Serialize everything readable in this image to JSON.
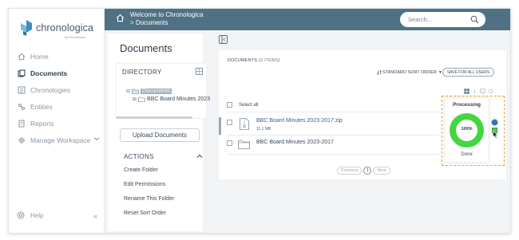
{
  "app": {
    "name": "chronologica",
    "tagline": "by Recordsure"
  },
  "nav": {
    "items": [
      {
        "label": "Home",
        "icon": "home-icon"
      },
      {
        "label": "Documents",
        "icon": "documents-icon",
        "active": true
      },
      {
        "label": "Chronologies",
        "icon": "chronologies-icon"
      },
      {
        "label": "Entities",
        "icon": "entities-icon"
      },
      {
        "label": "Reports",
        "icon": "reports-icon"
      },
      {
        "label": "Manage Workspace",
        "icon": "gear-icon"
      }
    ],
    "help_label": "Help"
  },
  "header": {
    "crumb_title": "Welcome to Chronologica",
    "crumb_sub": "> Documents",
    "search_placeholder": "Search..."
  },
  "documents": {
    "title": "Documents",
    "directory_label": "DIRECTORY",
    "tree": {
      "root": "Documents",
      "child": "BBC Board Minutes 2023"
    },
    "upload_label": "Upload Documents",
    "actions_label": "ACTIONS",
    "actions": [
      "Create Folder",
      "Edit Permissions",
      "Rename This Folder",
      "Reset Sort Order"
    ]
  },
  "list": {
    "title": "DOCUMENTS",
    "count": "(2 ITEMS)",
    "sort_label": "STANDARD SORT ORDER",
    "save_label": "SAVE FOR ALL USERS",
    "select_all": "Select all",
    "rows": [
      {
        "name": "BBC Board Minutes 2023-2017.zip",
        "size": "11.1 MB",
        "type": "zip"
      },
      {
        "name": "BBC Board Minutes 2023-2017",
        "type": "folder"
      }
    ],
    "pager": {
      "previous": "Previous",
      "page": "1",
      "next": "Next"
    }
  },
  "processing": {
    "title": "Processing",
    "percent": "100%",
    "progress": 1.0,
    "status": "Done"
  },
  "colors": {
    "header": "#4f7184",
    "accent_link": "#3c5f8a",
    "progress_green": "#44d640",
    "highlight_orange": "#f0a030"
  }
}
